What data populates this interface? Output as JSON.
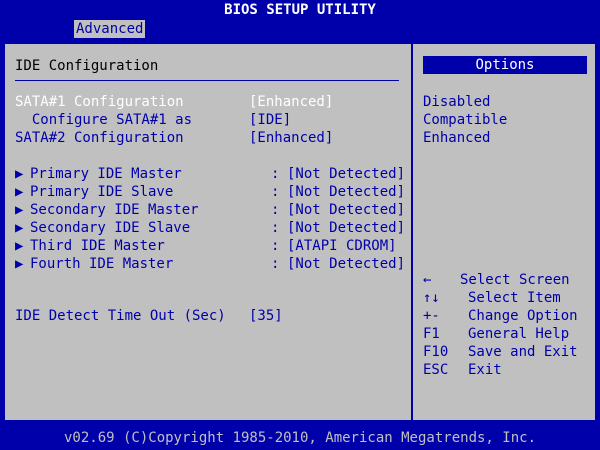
{
  "title": "BIOS SETUP UTILITY",
  "menu": {
    "active_tab": "Advanced"
  },
  "section": {
    "title": "IDE Configuration"
  },
  "settings": [
    {
      "label": "SATA#1 Configuration",
      "value": "[Enhanced]"
    },
    {
      "label": "  Configure SATA#1 as",
      "value": "[IDE]"
    },
    {
      "label": "SATA#2 Configuration",
      "value": "[Enhanced]"
    }
  ],
  "devices": [
    {
      "arrow": "▶",
      "label": "Primary IDE Master",
      "sep": ":",
      "value": "[Not Detected]"
    },
    {
      "arrow": "▶",
      "label": "Primary IDE Slave",
      "sep": ":",
      "value": "[Not Detected]"
    },
    {
      "arrow": "▶",
      "label": "Secondary IDE Master",
      "sep": ":",
      "value": "[Not Detected]"
    },
    {
      "arrow": "▶",
      "label": "Secondary IDE Slave",
      "sep": ":",
      "value": "[Not Detected]"
    },
    {
      "arrow": "▶",
      "label": "Third IDE Master",
      "sep": ":",
      "value": "[ATAPI CDROM]"
    },
    {
      "arrow": "▶",
      "label": "Fourth IDE Master",
      "sep": ":",
      "value": "[Not Detected]"
    }
  ],
  "timeout": {
    "label": "IDE Detect Time Out (Sec)",
    "value": "[35]"
  },
  "options": {
    "title": "Options",
    "items": [
      "Disabled",
      "Compatible",
      "Enhanced"
    ]
  },
  "keys": [
    {
      "key": "←",
      "desc": "Select Screen"
    },
    {
      "key": "↑↓",
      "desc": "Select Item"
    },
    {
      "key": "+-",
      "desc": "Change Option"
    },
    {
      "key": "F1",
      "desc": "General Help"
    },
    {
      "key": "F10",
      "desc": "Save and Exit"
    },
    {
      "key": "ESC",
      "desc": "Exit"
    }
  ],
  "footer": "v02.69 (C)Copyright 1985-2010, American Megatrends, Inc.",
  "colors": {
    "background": "#0000aa",
    "panel": "#c0c0c0",
    "highlight": "#ffffff",
    "text": "#0000aa"
  }
}
